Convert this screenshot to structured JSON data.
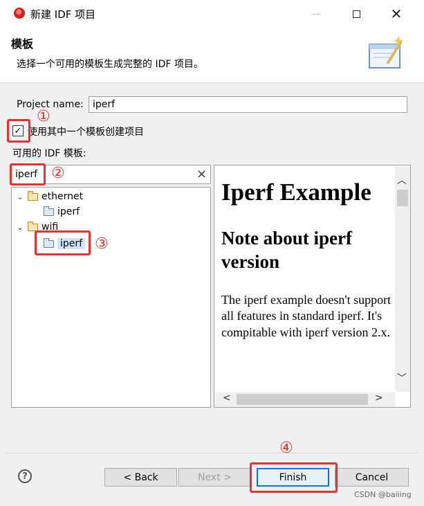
{
  "window": {
    "title": "新建 IDF 项目",
    "controls": {
      "minimize": "—",
      "maximize": "□",
      "close": "✕"
    }
  },
  "header": {
    "title": "模板",
    "description": "选择一个可用的模板生成完整的 IDF 项目。",
    "banner_icon": "wizard-banner-icon"
  },
  "form": {
    "project_name_label": "Project name:",
    "project_name_value": "iperf",
    "use_template_checked": true,
    "use_template_check_glyph": "✓",
    "use_template_label": "使用其中一个模板创建项目",
    "templates_label": "可用的 IDF 模板:"
  },
  "filter": {
    "value": "iperf",
    "clear_icon": "×"
  },
  "tree": {
    "items": [
      {
        "label": "ethernet",
        "expanded": true,
        "chevron": "⌄"
      },
      {
        "label": "iperf"
      },
      {
        "label": "wifi",
        "expanded": true,
        "chevron": "⌄"
      },
      {
        "label": "iperf",
        "selected": true
      }
    ]
  },
  "preview": {
    "h1": "Iperf Example",
    "h2": "Note about iperf version",
    "paragraph": "The iperf example doesn't support all features in standard iperf. It's compitable with iperf version 2.x."
  },
  "scrollbars": {
    "up": "︿",
    "down": "﹀",
    "left": "<",
    "right": ">"
  },
  "buttons": {
    "help": "?",
    "back": "< Back",
    "next": "Next >",
    "finish": "Finish",
    "cancel": "Cancel"
  },
  "annotations": [
    "①",
    "②",
    "③",
    "④"
  ],
  "watermark": "CSDN @baiiing",
  "colors": {
    "annotation_red": "#e5332f",
    "focus_blue": "#0078d7",
    "selection": "#cce4f7"
  }
}
